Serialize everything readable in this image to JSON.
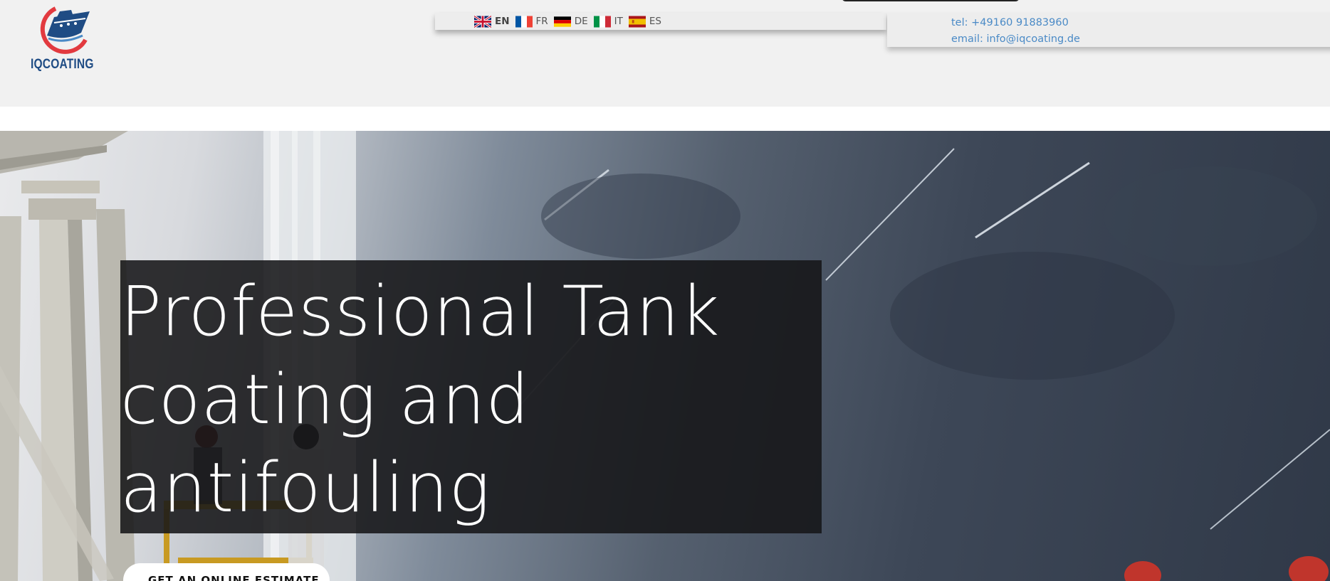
{
  "brand": {
    "name": "IQCOATING",
    "colors": {
      "primary": "#1f4c84",
      "accent": "#e23a3f",
      "link": "#4a8ac6"
    }
  },
  "languages": [
    {
      "code": "EN",
      "flag": "uk-flag-icon",
      "active": true
    },
    {
      "code": "FR",
      "flag": "france-flag-icon",
      "active": false
    },
    {
      "code": "DE",
      "flag": "germany-flag-icon",
      "active": false
    },
    {
      "code": "IT",
      "flag": "italy-flag-icon",
      "active": false
    },
    {
      "code": "ES",
      "flag": "spain-flag-icon",
      "active": false
    }
  ],
  "contact": {
    "phone": "tel: +49160 91883960",
    "email": "email: info@iqcoating.de"
  },
  "hero": {
    "headline_line1": "Professional Tank",
    "headline_line2": "coating and",
    "headline_line3": "antifouling",
    "cta_label": "GET AN ONLINE ESTIMATE"
  }
}
